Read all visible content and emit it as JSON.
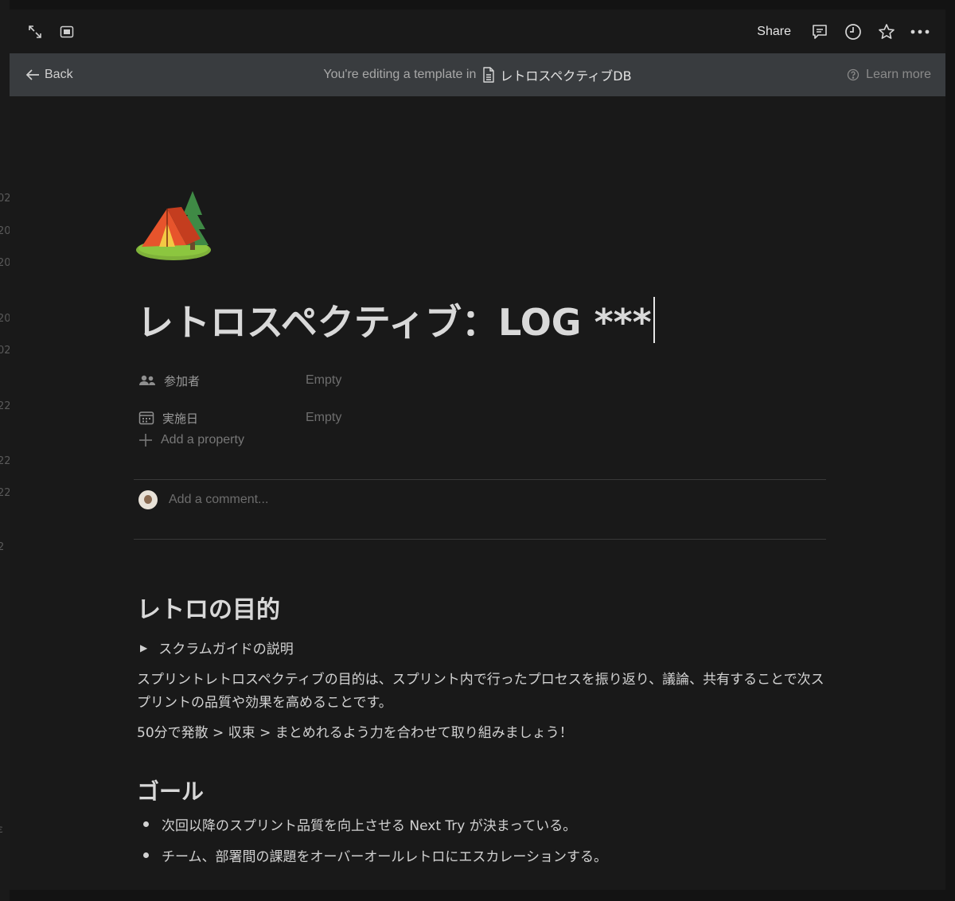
{
  "background_fragments": [
    "02",
    "20",
    "20",
    "20",
    "02",
    "22",
    "22",
    "22",
    "2",
    "ε"
  ],
  "topbar": {
    "share_label": "Share"
  },
  "banner": {
    "back_label": "Back",
    "editing_message": "You're editing a template in",
    "database_name": "レトロスペクティブDB",
    "learn_more_label": "Learn more"
  },
  "page": {
    "icon": "camping-tent-emoji",
    "title": "レトロスペクティブ：LOG ***",
    "properties": [
      {
        "name": "参加者",
        "value": "Empty",
        "icon": "people-icon"
      },
      {
        "name": "実施日",
        "value": "Empty",
        "icon": "calendar-icon"
      }
    ],
    "add_property_label": "Add a property",
    "comment_placeholder": "Add a comment..."
  },
  "body": {
    "heading_purpose": "レトロの目的",
    "toggle_label": "スクラムガイドの説明",
    "purpose_paragraph": "スプリントレトロスペクティブの目的は、スプリント内で行ったプロセスを振り返り、議論、共有することで次スプリントの品質や効果を高めることです。",
    "timebox_paragraph": "50分で発散 > 収束 > まとめれるよう力を合わせて取り組みましょう！",
    "heading_goal": "ゴール",
    "goal_items": [
      "次回以降のスプリント品質を向上させる Next Try が決まっている。",
      "チーム、部署間の課題をオーバーオールレトロにエスカレーションする。"
    ]
  },
  "colors": {
    "window_bg": "#191919",
    "banner_bg": "#393c3f",
    "outer_bg": "#131313"
  }
}
